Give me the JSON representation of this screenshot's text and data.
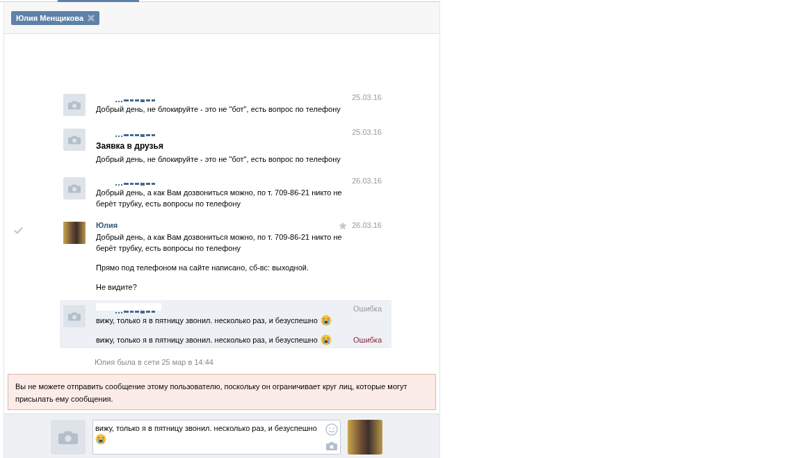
{
  "recipient_chip": {
    "label": "Юлия Менщикова"
  },
  "messages": [
    {
      "has_photo": false,
      "date": "25.03.16",
      "hovered": false,
      "highlighted": false,
      "texts": [
        {
          "text": "Добрый день, не блокируйте - это не \"бот\", есть вопрос по телефону"
        }
      ]
    },
    {
      "has_photo": false,
      "date": "25.03.16",
      "hovered": false,
      "highlighted": false,
      "subject": "Заявка в друзья",
      "texts": [
        {
          "text": "Добрый день, не блокируйте - это не \"бот\", есть вопрос по телефону"
        }
      ]
    },
    {
      "has_photo": false,
      "date": "26.03.16",
      "hovered": false,
      "highlighted": false,
      "texts": [
        {
          "text": "Добрый день, а как Вам дозвониться можно, по т. 709-86-21 никто не берёт трубку, есть вопросы по телефону"
        }
      ]
    },
    {
      "has_photo": true,
      "sender": "Юлия",
      "date": "26.03.16",
      "hovered": true,
      "highlighted": false,
      "texts": [
        {
          "text": "Добрый день, а как Вам дозвониться можно, по т. 709-86-21 никто не берёт трубку, есть вопросы по телефону"
        },
        {
          "text": "Прямо под телефоном на сайте написано, сб-вс: выходной."
        },
        {
          "text": "Не видите?"
        }
      ]
    },
    {
      "has_photo": false,
      "date": "Ошибка",
      "hovered": false,
      "highlighted": true,
      "texts": [
        {
          "text": "вижу, только я в пятницу звонил. несколько раз, и безуспешно",
          "emoji": true
        },
        {
          "text": "вижу, только я в пятницу звонил. несколько раз, и безуспешно",
          "emoji": true,
          "status": "Ошибка"
        }
      ]
    }
  ],
  "last_seen": "Юлия была в сети 25 мар в 14:44",
  "notice": "Вы не можете отправить сообщение этому пользователю, поскольку он ограничивает круг лиц, которые могут присылать ему сообщения.",
  "composer": {
    "value": "вижу, только я в пятницу звонил. несколько раз, и безуспешно",
    "emoji": true
  }
}
